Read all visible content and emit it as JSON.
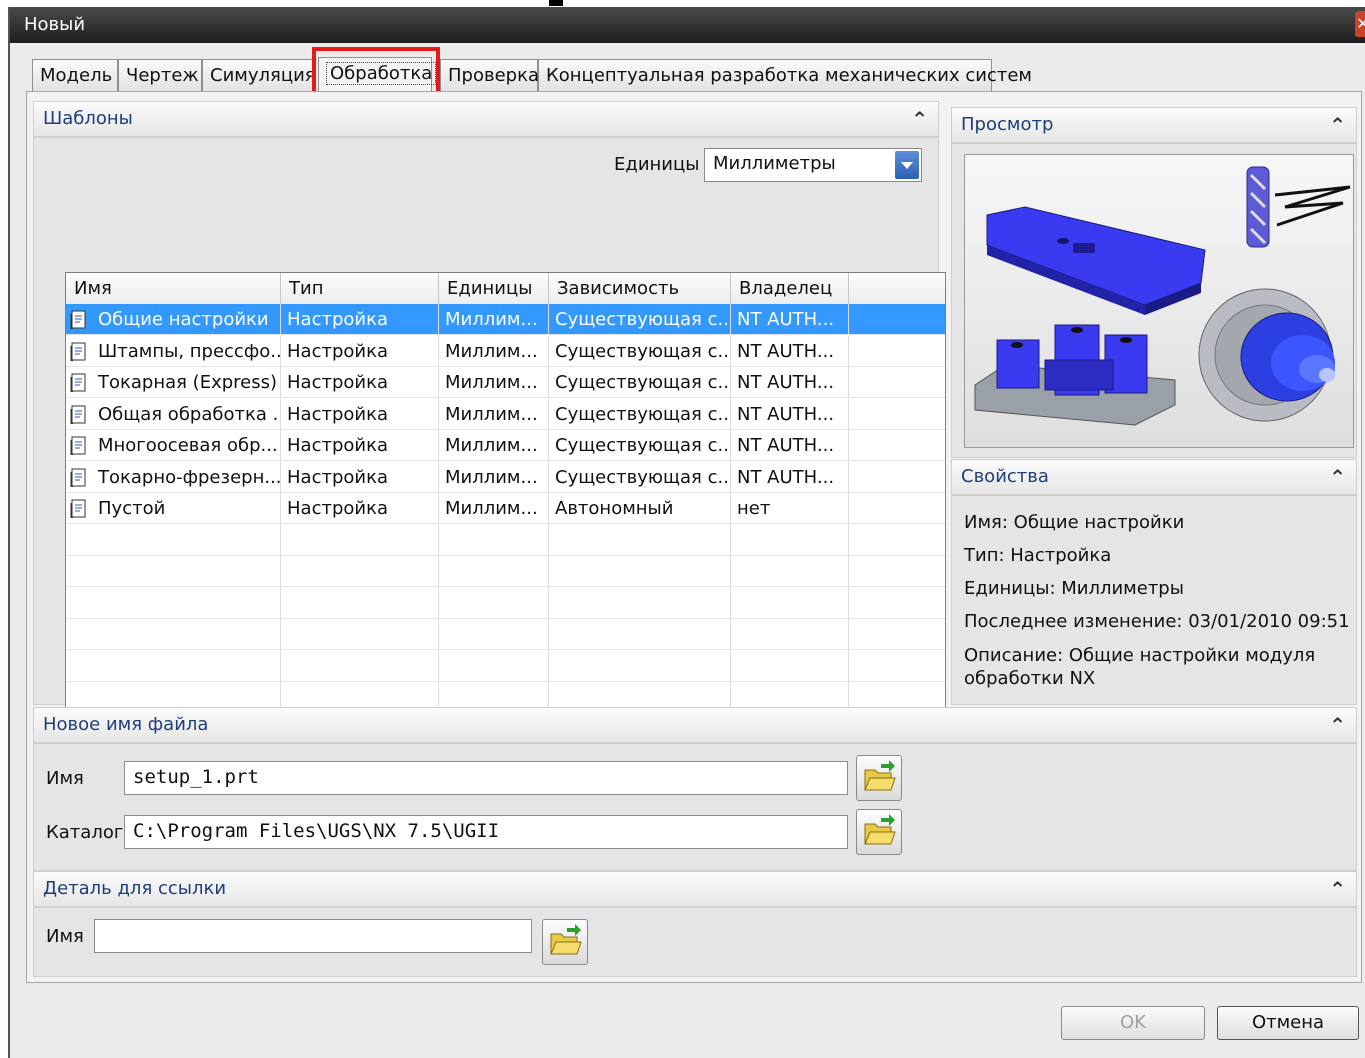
{
  "window": {
    "title": "Новый",
    "close_label": "✕"
  },
  "tabs": [
    {
      "label": "Модель"
    },
    {
      "label": "Чертеж"
    },
    {
      "label": "Симуляция"
    },
    {
      "label": "Обработка",
      "active": true
    },
    {
      "label": "Проверка"
    },
    {
      "label": "Концептуальная разработка механических систем"
    }
  ],
  "templates": {
    "header": "Шаблоны",
    "units_label": "Единицы",
    "units_value": "Миллиметры",
    "columns": [
      "Имя",
      "Тип",
      "Единицы",
      "Зависимость",
      "Владелец"
    ],
    "rows": [
      {
        "name": "Общие настройки",
        "type": "Настройка",
        "units": "Миллим...",
        "dependency": "Существующая с...",
        "owner": "NT AUTH...",
        "selected": true
      },
      {
        "name": "Штампы, прессфо...",
        "type": "Настройка",
        "units": "Миллим...",
        "dependency": "Существующая с...",
        "owner": "NT AUTH..."
      },
      {
        "name": "Токарная (Express)",
        "type": "Настройка",
        "units": "Миллим...",
        "dependency": "Существующая с...",
        "owner": "NT AUTH..."
      },
      {
        "name": "Общая обработка ...",
        "type": "Настройка",
        "units": "Миллим...",
        "dependency": "Существующая с...",
        "owner": "NT AUTH..."
      },
      {
        "name": "Многоосевая обр...",
        "type": "Настройка",
        "units": "Миллим...",
        "dependency": "Существующая с...",
        "owner": "NT AUTH..."
      },
      {
        "name": "Токарно-фрезерн...",
        "type": "Настройка",
        "units": "Миллим...",
        "dependency": "Существующая с...",
        "owner": "NT AUTH..."
      },
      {
        "name": "Пустой",
        "type": "Настройка",
        "units": "Миллим...",
        "dependency": "Автономный",
        "owner": "нет"
      }
    ]
  },
  "preview": {
    "header": "Просмотр"
  },
  "properties": {
    "header": "Свойства",
    "name": "Имя: Общие настройки",
    "type": "Тип: Настройка",
    "units": "Единицы: Миллиметры",
    "modified": "Последнее изменение: 03/01/2010 09:51",
    "description_line1": "Описание: Общие настройки модуля",
    "description_line2": "обработки NX"
  },
  "new_file": {
    "header": "Новое имя файла",
    "name_label": "Имя",
    "name_value": "setup_1.prt",
    "folder_label": "Каталог",
    "folder_value": "C:\\Program Files\\UGS\\NX 7.5\\UGII"
  },
  "reference": {
    "header": "Деталь для ссылки",
    "name_label": "Имя",
    "name_value": ""
  },
  "buttons": {
    "ok": "OK",
    "cancel": "Отмена"
  },
  "colors": {
    "selection": "#3399ff",
    "highlight_box": "#e21a1a",
    "section_title": "#1f3d7a",
    "model_blue": "#3a3af0"
  },
  "icons": [
    "template-icon",
    "dropdown-arrow-icon",
    "collapse-chevron-icon",
    "open-folder-icon"
  ]
}
